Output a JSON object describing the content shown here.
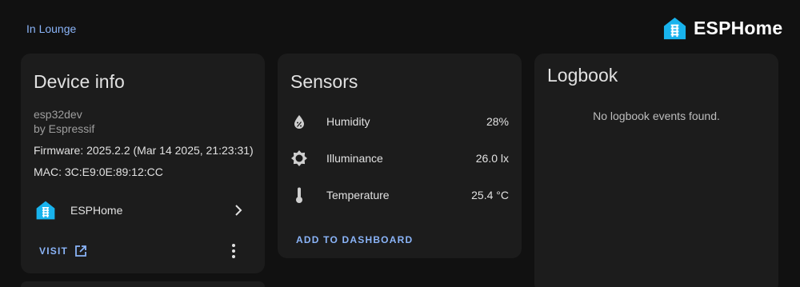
{
  "area_link": "In Lounge",
  "brand": {
    "name": "ESPHome",
    "logo_icon": "esphome-logo-icon",
    "logo_color": "#18b3ed"
  },
  "device_card": {
    "title": "Device info",
    "model": "esp32dev",
    "manufacturer": "by Espressif",
    "firmware": "Firmware: 2025.2.2 (Mar 14 2025, 21:23:31)",
    "mac": "MAC: 3C:E9:0E:89:12:CC",
    "integration": {
      "label": "ESPHome",
      "icon": "esphome-logo-icon"
    },
    "visit_label": "VISIT",
    "visit_icon": "open-in-new-icon",
    "more_icon": "dots-vertical-icon"
  },
  "sensors_card": {
    "title": "Sensors",
    "items": [
      {
        "name": "Humidity",
        "value": "28%",
        "icon": "water-percent-icon"
      },
      {
        "name": "Illuminance",
        "value": "26.0 lx",
        "icon": "brightness-icon"
      },
      {
        "name": "Temperature",
        "value": "25.4 °C",
        "icon": "thermometer-icon"
      }
    ],
    "add_label": "ADD TO DASHBOARD"
  },
  "logbook_card": {
    "title": "Logbook",
    "empty_text": "No logbook events found."
  },
  "colors": {
    "background": "#111111",
    "card": "#1c1c1c",
    "accent": "#8ab4f8",
    "text": "#e1e1e1",
    "secondary_text": "#9e9e9e"
  }
}
